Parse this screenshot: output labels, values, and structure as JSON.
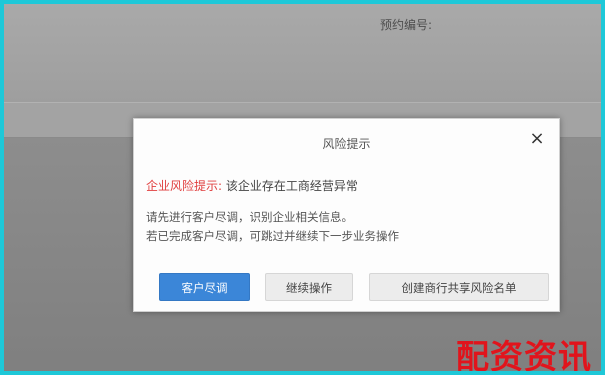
{
  "background": {
    "label": "预约编号:"
  },
  "dialog": {
    "title": "风险提示",
    "close_glyph": "×",
    "risk_label": "企业风险提示:",
    "risk_text": "该企业存在工商经营异常",
    "message_line1": "请先进行客户尽调，识别企业相关信息。",
    "message_line2": "若已完成客户尽调，可跳过并继续下一步业务操作",
    "buttons": {
      "due_diligence": "客户尽调",
      "continue": "继续操作",
      "create_list": "创建商行共享风险名单"
    }
  },
  "watermark": {
    "text": "配资资讯"
  },
  "colors": {
    "frame_border": "#1ec8d8",
    "primary_button": "#3b86d8",
    "risk_red": "#e03e3e",
    "watermark_red": "#e1141c"
  },
  "icons": {
    "close": "close-icon"
  }
}
